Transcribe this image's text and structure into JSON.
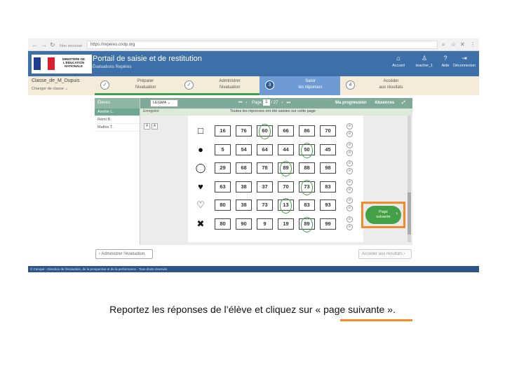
{
  "browser": {
    "security": "Non sécurisé",
    "url": "https://reperes.cndp.org"
  },
  "header": {
    "ministry": "MINISTÈRE DE L'ÉDUCATION NATIONALE",
    "title": "Portail de saisie et de restitution",
    "subtitle": "Évaluations Repères",
    "nav": [
      {
        "icon": "⌂",
        "label": "Accueil"
      },
      {
        "icon": "♙",
        "label": "teacher_1"
      },
      {
        "icon": "?",
        "label": "Aide"
      },
      {
        "icon": "⇥",
        "label": "Déconnexion"
      }
    ]
  },
  "class_bar": {
    "class_name": "Classe_de_M_Dupuis",
    "change_class": "Changer de classe ⌄"
  },
  "steps": [
    {
      "marker": "✓",
      "line1": "Préparer",
      "line2": "l'évaluation",
      "state": "done"
    },
    {
      "marker": "✓",
      "line1": "Administrer",
      "line2": "l'évaluation",
      "state": "done"
    },
    {
      "marker": "3",
      "line1": "Saisir",
      "line2": "les réponses",
      "state": "active"
    },
    {
      "marker": "4",
      "line1": "Accéder",
      "line2": "aux résultats",
      "state": "todo"
    }
  ],
  "students": {
    "header": "Élèves",
    "list": [
      "Amélie L.",
      "Rémi B.",
      "Mathis T."
    ]
  },
  "toolbar": {
    "student_select": "LEGMA ⌄",
    "first": "⏮",
    "prev": "‹",
    "page_label": "Page",
    "page_current": "1",
    "page_total": "/ 27",
    "next": "›",
    "last": "⏭",
    "progress": "Ma progression",
    "absences": "Absences",
    "expand": "⤢"
  },
  "info": {
    "saved": "Enregistré",
    "message": "Toutes les réponses ont été saisies sur cette page"
  },
  "abs_controls": [
    "A",
    "A"
  ],
  "grid": [
    {
      "icon_name": "square-icon",
      "icon": "□",
      "values": [
        "16",
        "76",
        "60",
        "66",
        "86",
        "70"
      ],
      "selected": 2
    },
    {
      "icon_name": "blob-icon",
      "icon": "●",
      "values": [
        "5",
        "54",
        "64",
        "44",
        "50",
        "45"
      ],
      "selected": 4
    },
    {
      "icon_name": "oval-icon",
      "icon": "◯",
      "values": [
        "29",
        "68",
        "78",
        "89",
        "88",
        "98"
      ],
      "selected": 3
    },
    {
      "icon_name": "heart-icon",
      "icon": "♥",
      "values": [
        "63",
        "38",
        "37",
        "70",
        "73",
        "83"
      ],
      "selected": 4
    },
    {
      "icon_name": "heart-outline-icon",
      "icon": "♡",
      "values": [
        "80",
        "38",
        "73",
        "13",
        "83",
        "93"
      ],
      "selected": 3
    },
    {
      "icon_name": "cross-icon",
      "icon": "✖",
      "values": [
        "80",
        "90",
        "9",
        "19",
        "89",
        "99"
      ],
      "selected": 4
    }
  ],
  "row_controls": [
    "⊘",
    "⊘"
  ],
  "next_page": {
    "line1": "Page",
    "line2": "suivante",
    "chev": "›"
  },
  "footer": {
    "back": "‹  Administrer l'évaluation",
    "forward": "Accéder aux résultats  ›",
    "copyright": "© Canopé - Direction de l'évaluation, de la prospective et de la performance - Tous droits réservés"
  },
  "caption": "Reportez les réponses de l’élève et cliquez sur « page suivante »."
}
